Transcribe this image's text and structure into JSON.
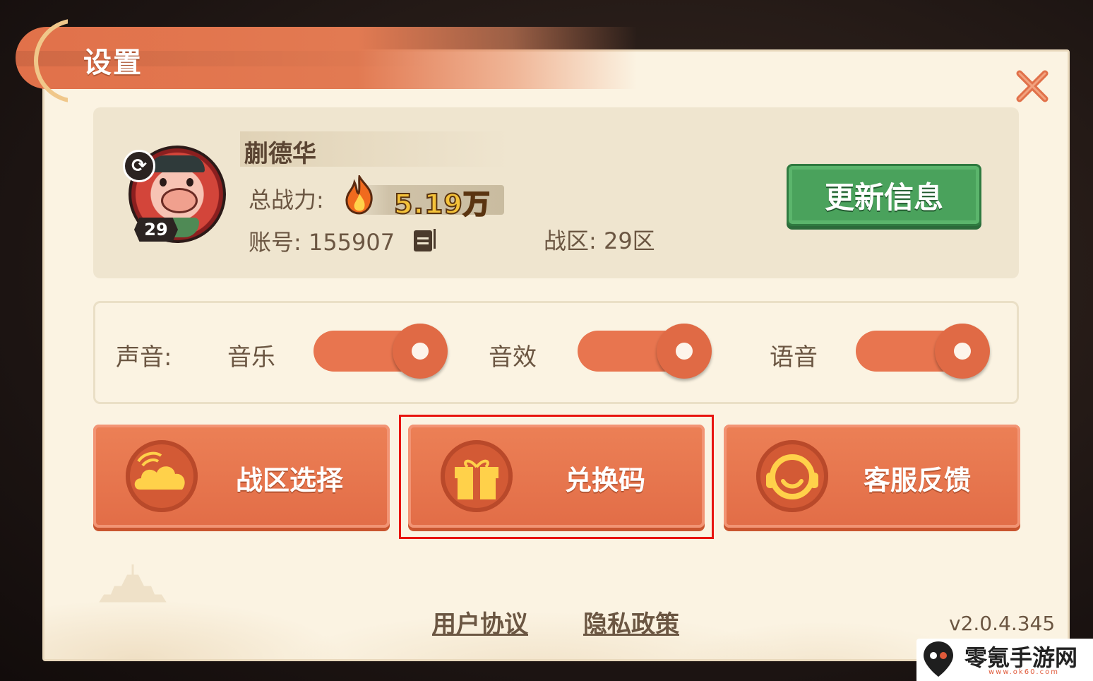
{
  "dialog": {
    "title": "设置"
  },
  "profile": {
    "name": "蒯德华",
    "level": "29",
    "power_label": "总战力:",
    "power_value": "5.19万",
    "account_text": "账号:  155907",
    "zone_text": "战区:  29区",
    "update_button": "更新信息"
  },
  "sound": {
    "label": "声音:",
    "toggles": [
      {
        "label": "音乐",
        "on": true
      },
      {
        "label": "音效",
        "on": true
      },
      {
        "label": "语音",
        "on": true
      }
    ]
  },
  "actions": [
    {
      "label": "战区选择",
      "icon": "cloud-icon"
    },
    {
      "label": "兑换码",
      "icon": "gift-icon"
    },
    {
      "label": "客服反馈",
      "icon": "headset-icon"
    }
  ],
  "footer": {
    "user_agreement": "用户协议",
    "privacy_policy": "隐私政策",
    "version": "v2.0.4.345"
  },
  "watermark": {
    "text": "零氪手游网",
    "sub": "www.ok60.com"
  },
  "colors": {
    "accent": "#e26d47",
    "green": "#4aa25c",
    "highlight": "#e8140f"
  }
}
